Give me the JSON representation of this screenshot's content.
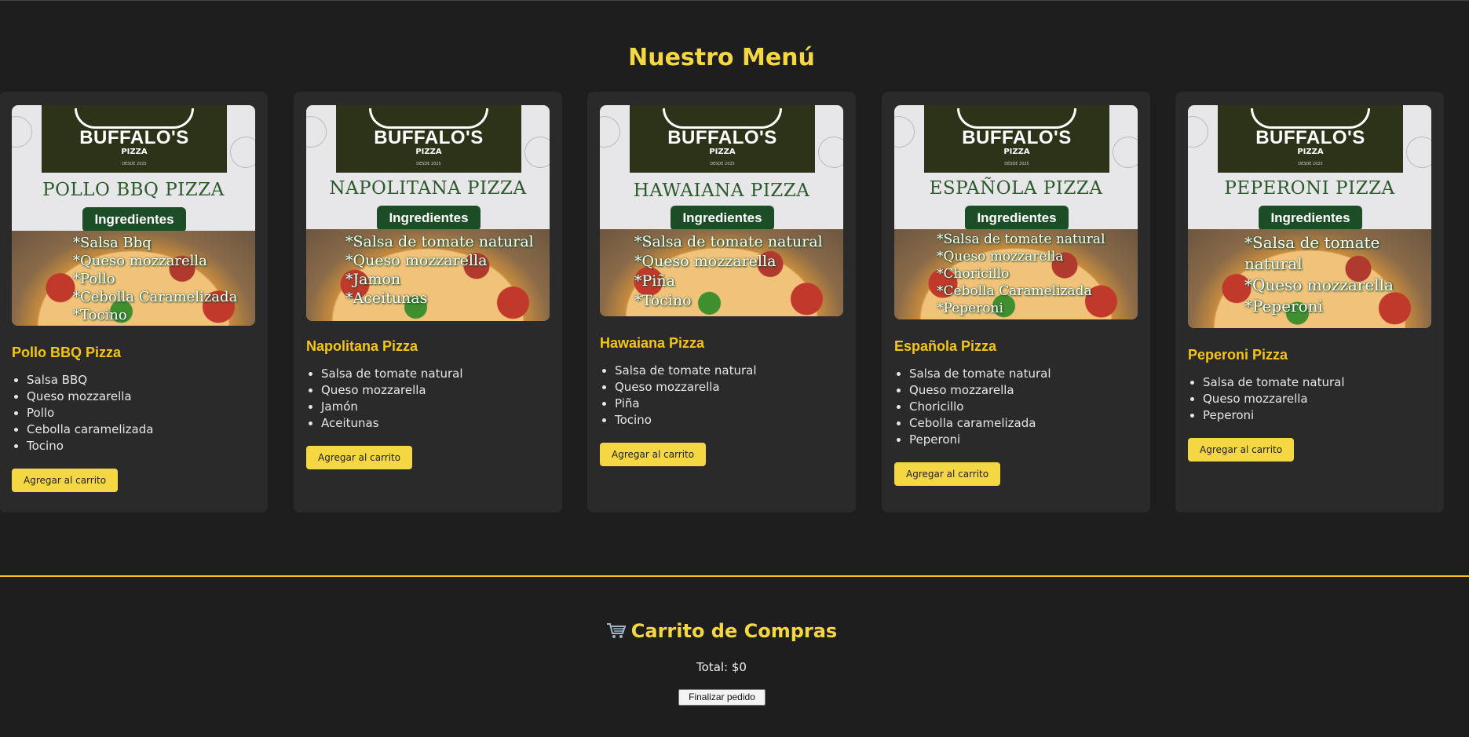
{
  "menu": {
    "title": "Nuestro Menú"
  },
  "brand": {
    "name": "BUFFALO'S",
    "sub": "PIZZA",
    "est": "DESDE 2025"
  },
  "image_badge": "Ingredientes",
  "add_to_cart_label": "Agregar al carrito",
  "cards": [
    {
      "title": "Pollo BBQ Pizza",
      "image_title": "POLLO BBQ PIZZA",
      "image_ingredients": [
        "*Salsa Bbq",
        "*Queso mozzarella",
        "*Pollo",
        "*Cebolla Caramelizada",
        "*Tocino"
      ],
      "ingredients": [
        "Salsa BBQ",
        "Queso mozzarella",
        "Pollo",
        "Cebolla caramelizada",
        "Tocino"
      ]
    },
    {
      "title": "Napolitana Pizza",
      "image_title": "NAPOLITANA PIZZA",
      "image_ingredients": [
        "*Salsa de tomate natural",
        "*Queso mozzarella",
        "*Jamon",
        "*Aceitunas"
      ],
      "ingredients": [
        "Salsa de tomate natural",
        "Queso mozzarella",
        "Jamón",
        "Aceitunas"
      ]
    },
    {
      "title": "Hawaiana Pizza",
      "image_title": "HAWAIANA PIZZA",
      "image_ingredients": [
        "*Salsa de tomate natural",
        "*Queso mozzarella",
        "*Piña",
        "*Tocino"
      ],
      "ingredients": [
        "Salsa de tomate natural",
        "Queso mozzarella",
        "Piña",
        "Tocino"
      ]
    },
    {
      "title": "Española Pizza",
      "image_title": "ESPAÑOLA PIZZA",
      "image_ingredients": [
        "*Salsa de tomate natural",
        "*Queso mozzarella",
        "*Choricillo",
        "*Cebolla Caramelizada",
        "*Peperoni"
      ],
      "ingredients": [
        "Salsa de tomate natural",
        "Queso mozzarella",
        "Choricillo",
        "Cebolla caramelizada",
        "Peperoni"
      ]
    },
    {
      "title": "Peperoni Pizza",
      "image_title": "PEPERONI PIZZA",
      "image_ingredients": [
        "*Salsa de tomate",
        "natural",
        "*Queso mozzarella",
        "*Peperoni"
      ],
      "ingredients": [
        "Salsa de tomate natural",
        "Queso mozzarella",
        "Peperoni"
      ]
    }
  ],
  "cart": {
    "title": "Carrito de Compras",
    "total": "Total: $0",
    "checkout_label": "Finalizar pedido"
  },
  "colors": {
    "accent": "#f5d643",
    "background": "#1e1e1e",
    "card": "#2a2a2a",
    "badge_green": "#1d4d26"
  }
}
